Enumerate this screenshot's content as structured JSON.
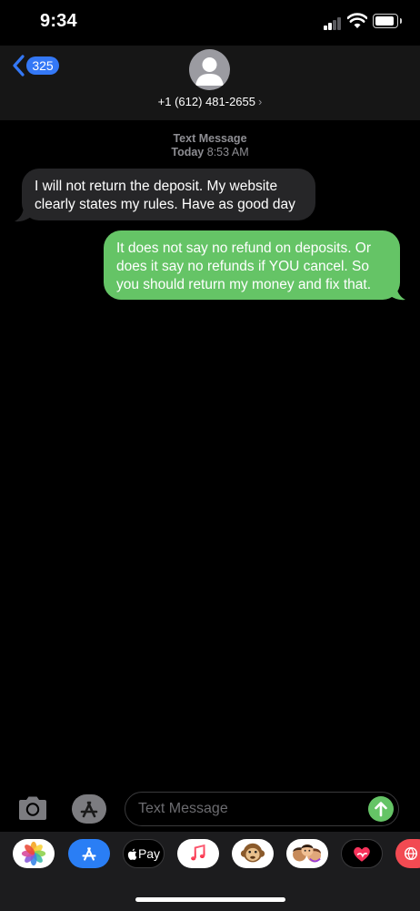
{
  "status_bar": {
    "time": "9:34",
    "icons": [
      "cellular-signal-icon",
      "wifi-icon",
      "battery-icon"
    ]
  },
  "header": {
    "back_count": "325",
    "contact_label": "+1 (612) 481-2655",
    "chevron": "›"
  },
  "conversation": {
    "label_type": "Text Message",
    "label_day": "Today",
    "label_time": "8:53 AM",
    "messages": [
      {
        "direction": "incoming",
        "text": "I will not return the deposit. My website clearly states my rules. Have as good day"
      },
      {
        "direction": "outgoing",
        "text": "It does not say no refund on deposits. Or does it say no refunds if YOU cancel. So you should return my money and fix that."
      }
    ]
  },
  "input_bar": {
    "placeholder": "Text Message"
  },
  "app_tray": {
    "apple_pay_label": "Pay",
    "apps": [
      "photos-app",
      "app-store-app",
      "apple-pay-app",
      "music-app",
      "monkey-animoji-app",
      "memoji-app",
      "digital-touch-app",
      "search-images-app"
    ]
  },
  "colors": {
    "background": "#000000",
    "header": "#161616",
    "incoming_bubble": "#262628",
    "outgoing_bubble": "#65c466",
    "accent_blue": "#3478f6",
    "secondary_text": "#8e8e93"
  }
}
